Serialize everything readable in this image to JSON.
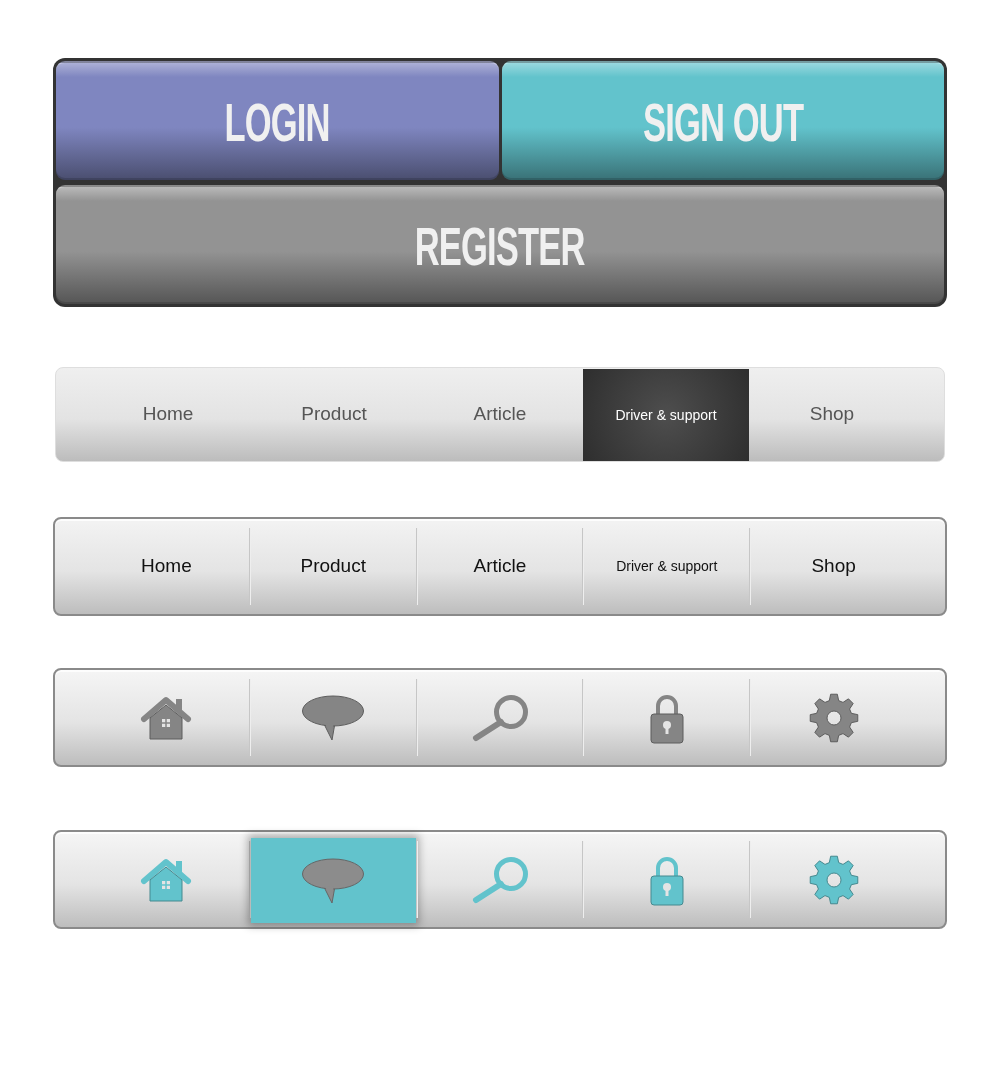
{
  "button_panel": {
    "buttons": [
      {
        "label": "LOGIN",
        "color": "#7f86c0"
      },
      {
        "label": "SIGN OUT",
        "color": "#62c3cc"
      },
      {
        "label": "REGISTER",
        "color": "#939393"
      }
    ]
  },
  "nav_bars": [
    {
      "kind": "plain",
      "items": [
        {
          "label": "Home",
          "selected": false
        },
        {
          "label": "Product",
          "selected": false
        },
        {
          "label": "Article",
          "selected": false
        },
        {
          "label": "Driver & support",
          "selected": true
        },
        {
          "label": "Shop",
          "selected": false
        }
      ]
    },
    {
      "kind": "divided",
      "items": [
        {
          "label": "Home",
          "selected": false
        },
        {
          "label": "Product",
          "selected": false
        },
        {
          "label": "Article",
          "selected": false
        },
        {
          "label": "Driver & support",
          "selected": false
        },
        {
          "label": "Shop",
          "selected": false
        }
      ]
    }
  ],
  "icon_bars": [
    {
      "color": "#858585",
      "items": [
        {
          "selected": false
        },
        {
          "selected": false
        },
        {
          "selected": false
        },
        {
          "selected": false
        },
        {
          "selected": false
        }
      ]
    },
    {
      "color": "#62c3cc",
      "items": [
        {
          "selected": false
        },
        {
          "selected": true
        },
        {
          "selected": false
        },
        {
          "selected": false
        },
        {
          "selected": false
        }
      ]
    }
  ]
}
